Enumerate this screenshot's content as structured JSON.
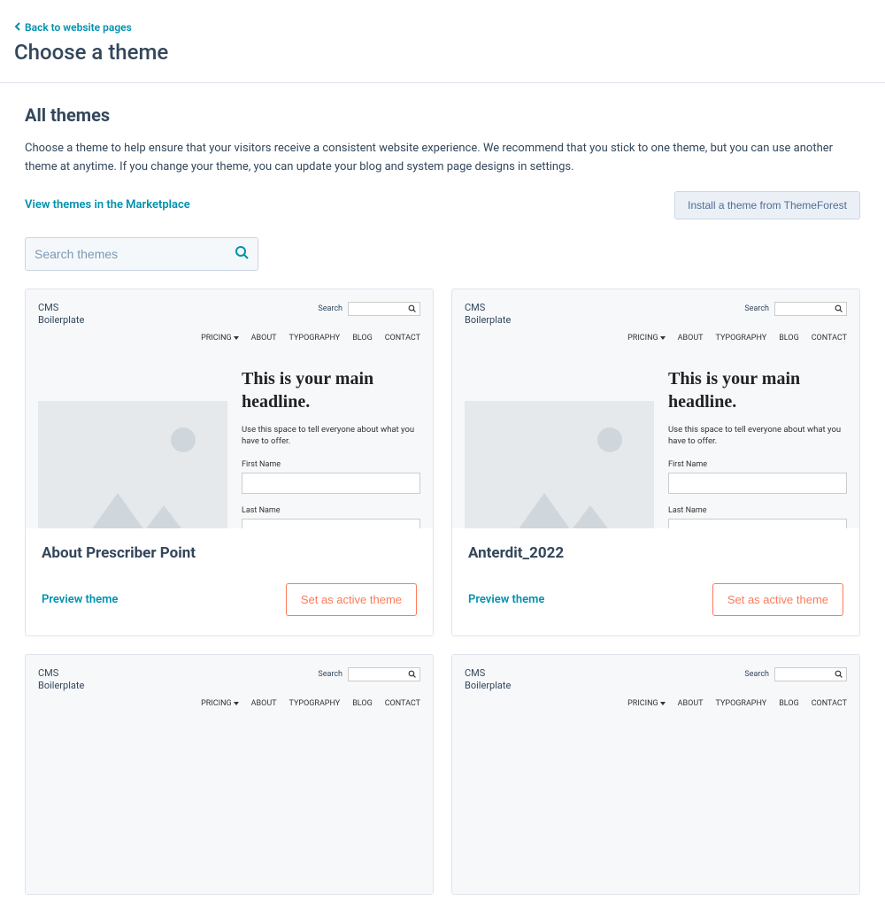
{
  "header": {
    "back_label": "Back to website pages",
    "page_title": "Choose a theme"
  },
  "section": {
    "title": "All themes",
    "description": "Choose a theme to help ensure that your visitors receive a consistent website experience. We recommend that you stick to one theme, but you can use another theme at anytime. If you change your theme, you can update your blog and system page designs in settings.",
    "marketplace_link": "View themes in the Marketplace",
    "install_button": "Install a theme from ThemeForest"
  },
  "search": {
    "placeholder": "Search themes"
  },
  "preview_common": {
    "logo_line1": "CMS",
    "logo_line2": "Boilerplate",
    "search_label": "Search",
    "nav": {
      "pricing": "PRICING",
      "about": "ABOUT",
      "typography": "TYPOGRAPHY",
      "blog": "BLOG",
      "contact": "CONTACT"
    },
    "headline": "This is your main headline.",
    "sub": "Use this space to tell everyone about what you have to offer.",
    "first_name": "First Name",
    "last_name": "Last Name"
  },
  "themes": [
    {
      "title": "About Prescriber Point"
    },
    {
      "title": "Anterdit_2022"
    },
    {
      "title": ""
    },
    {
      "title": ""
    }
  ],
  "card_actions": {
    "preview": "Preview theme",
    "set_active": "Set as active theme"
  }
}
